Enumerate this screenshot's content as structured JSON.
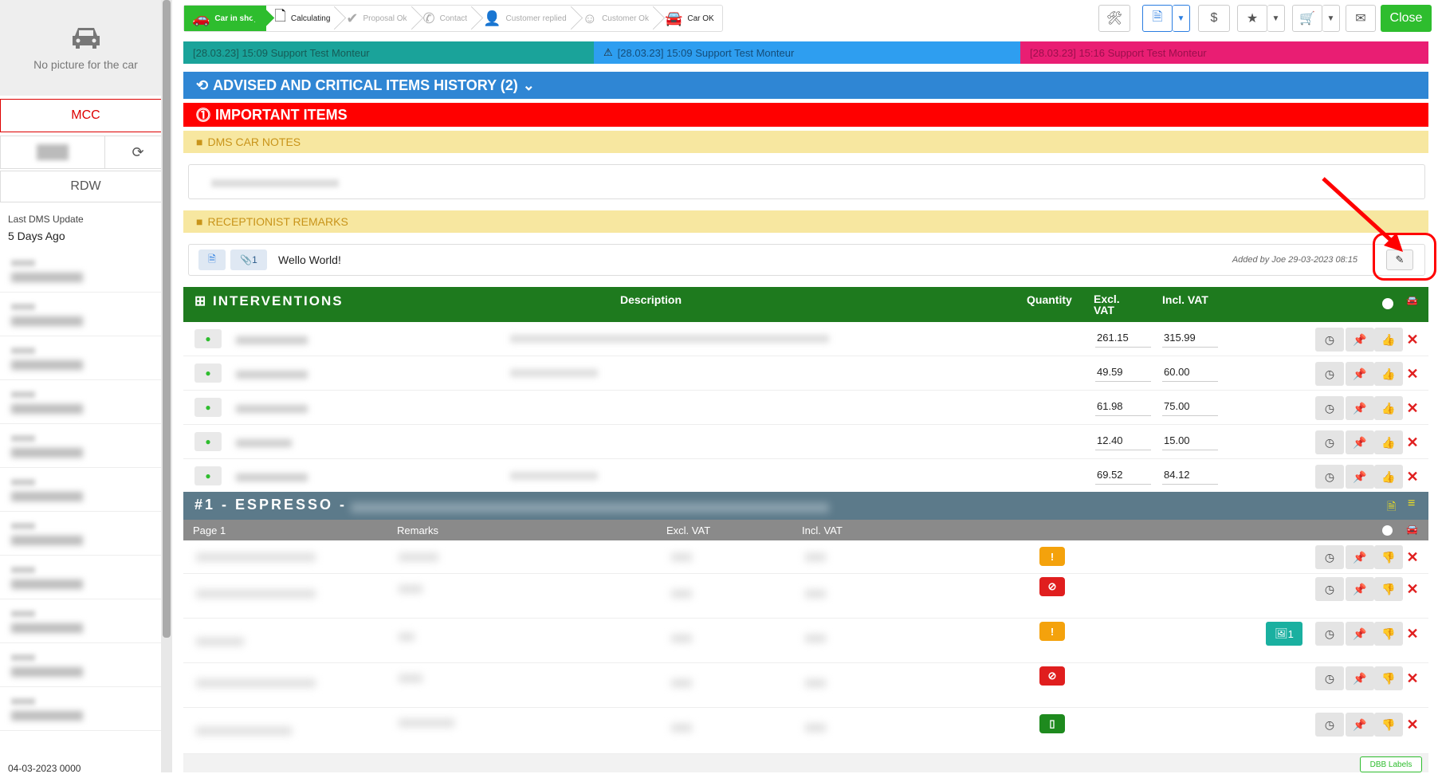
{
  "sidebar": {
    "no_picture": "No picture for the car",
    "mcc": "MCC",
    "rdw": "RDW",
    "last_dms_label": "Last DMS Update",
    "last_dms_value": "5 Days Ago",
    "footer_date": "04-03-2023 0000"
  },
  "toolbar": {
    "steps": [
      {
        "label": "Car in shop",
        "state": "active",
        "icon": "car-icon"
      },
      {
        "label": "Calculating",
        "state": "done",
        "icon": "document-icon"
      },
      {
        "label": "Proposal Ok",
        "state": "pending",
        "icon": "check-icon"
      },
      {
        "label": "Contact",
        "state": "pending",
        "icon": "phone-icon"
      },
      {
        "label": "Customer replied",
        "state": "pending",
        "icon": "user-check-icon"
      },
      {
        "label": "Customer Ok",
        "state": "pending",
        "icon": "smile-icon"
      },
      {
        "label": "Car OK",
        "state": "done",
        "icon": "car-front-icon"
      }
    ],
    "buttons": {
      "dollar": "$",
      "close": "Close"
    }
  },
  "status_messages": [
    {
      "text": "[28.03.23] 15:09 Support Test Monteur",
      "color": "#1aa39a"
    },
    {
      "text": "[28.03.23] 15:09 Support Test Monteur",
      "color": "#2e9ef0"
    },
    {
      "text": "[28.03.23] 15:16 Support Test Monteur",
      "color": "#e91e73"
    }
  ],
  "sections": {
    "history": "ADVISED AND CRITICAL ITEMS HISTORY (2)",
    "important": "IMPORTANT ITEMS",
    "dms_notes": "DMS CAR NOTES",
    "receptionist": "RECEPTIONIST REMARKS"
  },
  "remark": {
    "attachments": "1",
    "text": "Wello World!",
    "meta": "Added by Joe        29-03-2023 08:15"
  },
  "interventions": {
    "title": "INTERVENTIONS",
    "columns": {
      "description": "Description",
      "quantity": "Quantity",
      "excl": "Excl.\nVAT",
      "incl": "Incl. VAT"
    },
    "rows": [
      {
        "excl": "261.15",
        "incl": "315.99"
      },
      {
        "excl": "49.59",
        "incl": "60.00"
      },
      {
        "excl": "61.98",
        "incl": "75.00"
      },
      {
        "excl": "12.40",
        "incl": "15.00"
      },
      {
        "excl": "69.52",
        "incl": "84.12"
      }
    ]
  },
  "espresso": {
    "title": "#1 - ESPRESSO -",
    "columns": {
      "page": "Page 1",
      "remarks": "Remarks",
      "excl": "Excl. VAT",
      "incl": "Incl. VAT"
    },
    "rows": [
      {
        "badge": "!",
        "badge_color": "orange"
      },
      {
        "badge": "⊘",
        "badge_color": "red"
      },
      {
        "badge": "!",
        "badge_color": "orange",
        "photos": "1"
      },
      {
        "badge": "⊘",
        "badge_color": "red"
      },
      {
        "badge": "▯",
        "badge_color": "green"
      }
    ],
    "dbb_label": "DBB Labels"
  }
}
